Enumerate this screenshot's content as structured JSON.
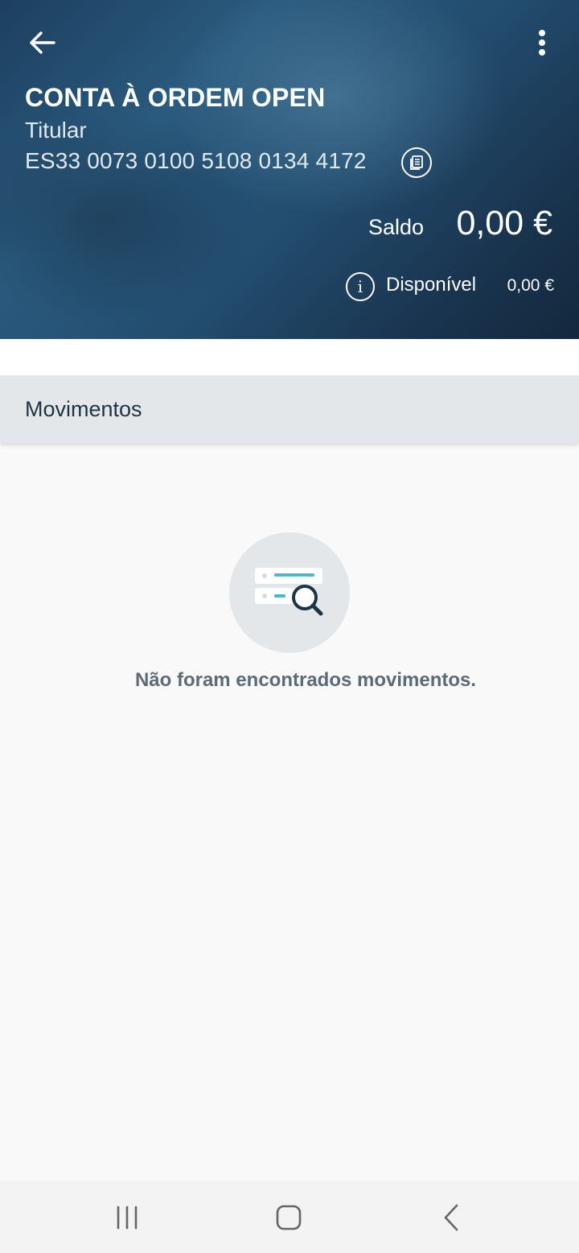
{
  "header": {
    "title": "CONTA À ORDEM OPEN",
    "subtitle": "Titular",
    "iban": "ES33 0073 0100 5108 0134 4172",
    "saldo_label": "Saldo",
    "saldo_value": "0,00 €",
    "disponivel_label": "Disponível",
    "disponivel_value": "0,00 €",
    "icons": [
      "arrow-left-icon",
      "more-vertical-icon",
      "copy-document-icon",
      "info-icon"
    ]
  },
  "section": {
    "title": "Movimentos"
  },
  "empty_state": {
    "icon": "document-search-icon",
    "message": "Não foram encontrados movimentos."
  },
  "system_nav": {
    "icons": [
      "recent-apps-icon",
      "home-icon",
      "back-icon"
    ]
  },
  "colors": {
    "header_dark": "#1d3f5f",
    "section_bar": "#e3e7e9",
    "accent_teal": "#4bb7c9",
    "text_dark": "#1c3446"
  }
}
